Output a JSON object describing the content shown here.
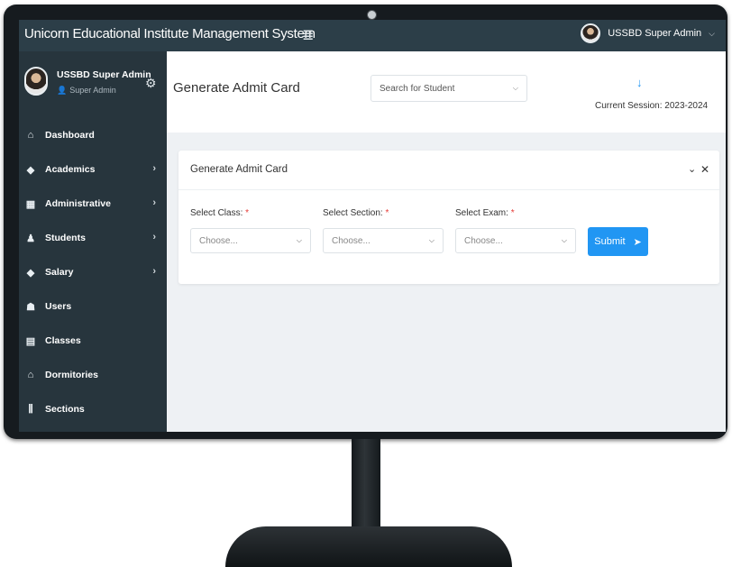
{
  "app": {
    "title": "Unicorn Educational Institute Management System"
  },
  "topbar": {
    "menu_icon": "hamburger-icon",
    "user_name": "USSBD Super Admin",
    "user_caret": "⌵"
  },
  "sidebar": {
    "profile": {
      "name": "USSBD Super Admin",
      "role": "Super Admin"
    },
    "items": [
      {
        "label": "Dashboard",
        "icon": "home-icon",
        "glyph": "⌂",
        "has_submenu": false
      },
      {
        "label": "Academics",
        "icon": "graduation-cap-icon",
        "glyph": "🎓",
        "has_submenu": true
      },
      {
        "label": "Administrative",
        "icon": "building-icon",
        "glyph": "▦",
        "has_submenu": true
      },
      {
        "label": "Students",
        "icon": "student-icon",
        "glyph": "👤",
        "has_submenu": true
      },
      {
        "label": "Salary",
        "icon": "salary-cap-icon",
        "glyph": "🎓",
        "has_submenu": true
      },
      {
        "label": "Users",
        "icon": "users-icon",
        "glyph": "👥",
        "has_submenu": false
      },
      {
        "label": "Classes",
        "icon": "clipboard-icon",
        "glyph": "▤",
        "has_submenu": false
      },
      {
        "label": "Dormitories",
        "icon": "dormitory-icon",
        "glyph": "⌂",
        "has_submenu": false
      },
      {
        "label": "Sections",
        "icon": "sections-icon",
        "glyph": "⫼",
        "has_submenu": false
      }
    ]
  },
  "header": {
    "page_title": "Generate Admit Card",
    "search_placeholder": "Search for Student",
    "session_label": "Current Session: 2023-2024"
  },
  "card": {
    "title": "Generate Admit Card",
    "fields": [
      {
        "label": "Select Class:",
        "placeholder": "Choose..."
      },
      {
        "label": "Select Section:",
        "placeholder": "Choose..."
      },
      {
        "label": "Select Exam:",
        "placeholder": "Choose..."
      }
    ],
    "required_mark": "*",
    "submit_label": "Submit"
  },
  "colors": {
    "topbar": "#2c3e48",
    "sidebar": "#27353d",
    "accent": "#2196f3",
    "required": "#e53935"
  }
}
